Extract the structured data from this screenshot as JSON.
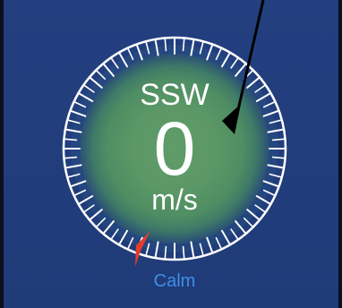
{
  "wind": {
    "direction": "SSW",
    "speed": "0",
    "unit": "m/s",
    "condition": "Calm"
  },
  "dial": {
    "glow_color": "#5d9a68",
    "ring_color": "#ffffff",
    "marker_color": "#e63b2e",
    "pointer_color": "#000000"
  }
}
